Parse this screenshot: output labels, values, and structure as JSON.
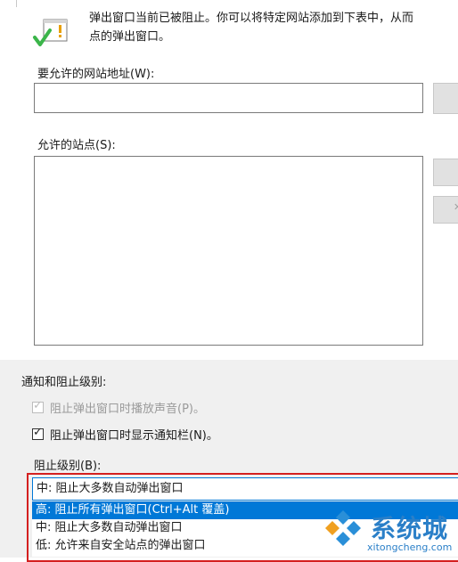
{
  "info": {
    "line1": "弹出窗口当前已被阻止。你可以将特定网站添加到下表中，从而",
    "line2": "点的弹出窗口。"
  },
  "url_label": "要允许的网站地址(W):",
  "url_input": {
    "value": "",
    "placeholder": ""
  },
  "sites_label": "允许的站点(S):",
  "section_label": "通知和阻止级别:",
  "checkboxes": [
    {
      "label": "阻止弹出窗口时播放声音(P)。",
      "checked": true,
      "disabled": true
    },
    {
      "label": "阻止弹出窗口时显示通知栏(N)。",
      "checked": true,
      "disabled": false
    }
  ],
  "block_level_label": "阻止级别(B):",
  "dropdown": {
    "selected": "中: 阻止大多数自动弹出窗口",
    "options": [
      "高: 阻止所有弹出窗口(Ctrl+Alt 覆盖)",
      "中: 阻止大多数自动弹出窗口",
      "低: 允许来自安全站点的弹出窗口"
    ],
    "highlighted_index": 0
  },
  "watermark": {
    "title": "系统城",
    "url": "xitongcheng.com"
  },
  "colors": {
    "selection": "#0078d7",
    "highlight_border": "#d42020",
    "watermark": "#2a7fc8"
  }
}
